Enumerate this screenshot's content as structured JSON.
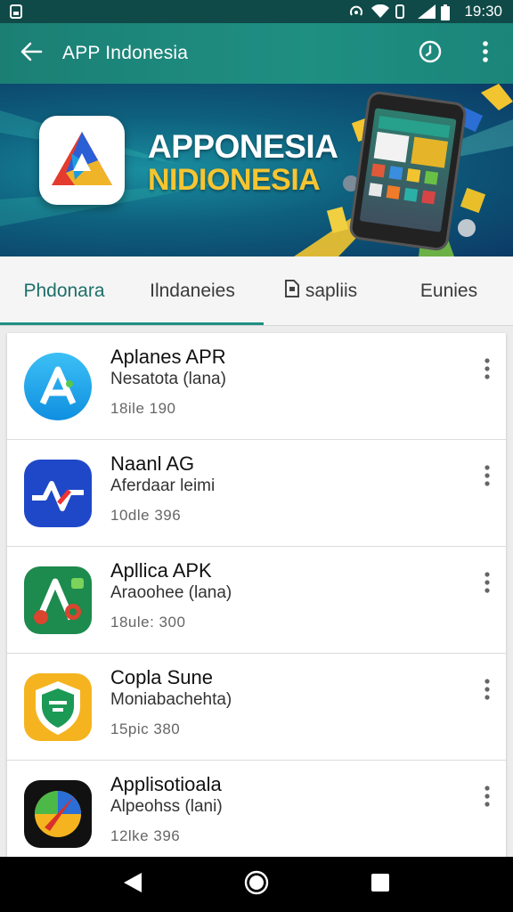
{
  "status_bar": {
    "time": "19:30"
  },
  "app_bar": {
    "title": "APP Indonesia"
  },
  "banner": {
    "line1": "APPONESIA",
    "line2": "NIDIONESIA"
  },
  "tabs": [
    {
      "label": "Phdonara",
      "active": true
    },
    {
      "label": "Ilndaneies",
      "active": false
    },
    {
      "label": "sapliis",
      "active": false,
      "icon": "document-icon"
    },
    {
      "label": "Eunies",
      "active": false
    }
  ],
  "apps": [
    {
      "title": "Aplanes APR",
      "subtitle": "Nesatota (lana)",
      "meta": "18ile 190",
      "icon": "blue-a-icon"
    },
    {
      "title": "Naanl AG",
      "subtitle": "Aferdaar leimi",
      "meta": "10dle 396",
      "icon": "pulse-icon"
    },
    {
      "title": "Apllica APK",
      "subtitle": "Araoohee (lana)",
      "meta": "18ule: 300",
      "icon": "green-a-icon"
    },
    {
      "title": "Copla Sune",
      "subtitle": "Moniabachehta)",
      "meta": "15pic 380",
      "icon": "shield-icon"
    },
    {
      "title": "Applisotioala",
      "subtitle": "Alpeohss (lani)",
      "meta": "12lke 396",
      "icon": "compass-icon"
    }
  ],
  "colors": {
    "accent": "#1f8f82",
    "status_bar": "#0f4a48",
    "banner_yellow": "#f6c531"
  }
}
